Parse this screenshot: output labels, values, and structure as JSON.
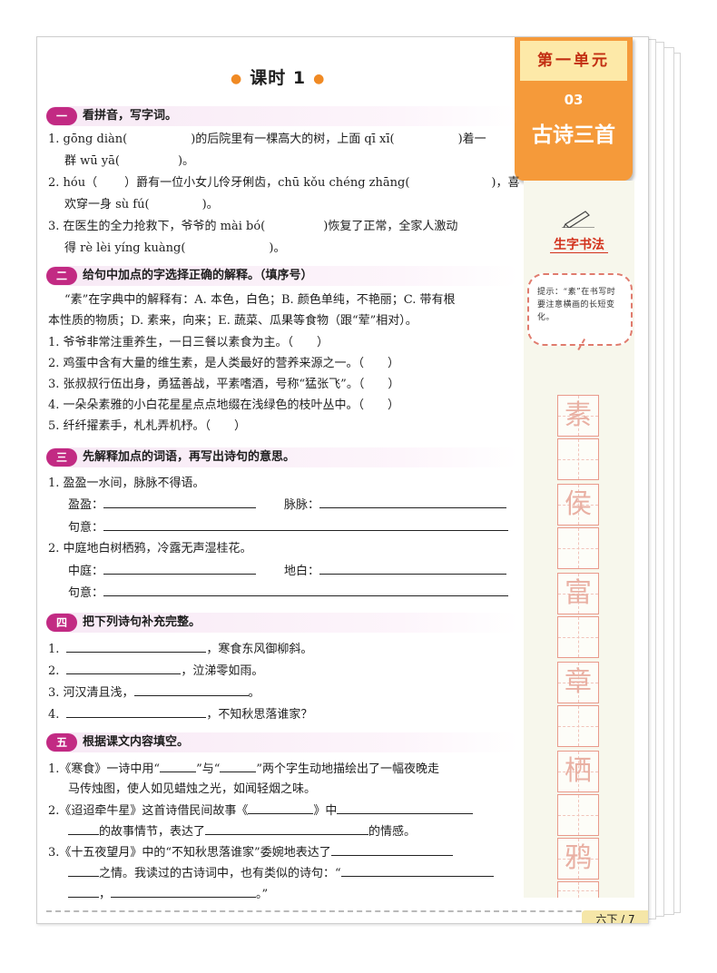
{
  "lesson_title": "课时 1",
  "unit": {
    "label": "第一单元",
    "number": "03",
    "title": "古诗三首"
  },
  "side": {
    "calligraphy_title": "生字书法",
    "tip": "提示：“素”在书写时要注意横画的长短变化。",
    "characters": [
      "素",
      "侯",
      "富",
      "章",
      "栖",
      "鸦"
    ]
  },
  "sections": [
    {
      "num": "一",
      "title": "看拼音，写字词。"
    },
    {
      "num": "二",
      "title": "给句中加点的字选择正确的解释。（填序号）"
    },
    {
      "num": "三",
      "title": "先解释加点的词语，再写出诗句的意思。"
    },
    {
      "num": "四",
      "title": "把下列诗句补充完整。"
    },
    {
      "num": "五",
      "title": "根据课文内容填空。"
    }
  ],
  "s1": {
    "l1a": "1. gōng diàn(",
    "l1b": ")的后院里有一棵高大的树，上面 qī xī(",
    "l1c": ")着一",
    "l2a": "群 wū yā(",
    "l2b": ")。",
    "l3a": "2. hóu（",
    "l3b": "）爵有一位小女儿伶牙俐齿，chū kǒu chéng zhāng(",
    "l3c": ")，喜",
    "l4a": "欢穿一身 sù fú(",
    "l4b": ")。",
    "l5a": "3. 在医生的全力抢救下，爷爷的 mài bó(",
    "l5b": ")恢复了正常，全家人激动",
    "l6a": "得 rè lèi yíng kuàng(",
    "l6b": ")。"
  },
  "s2": {
    "def1": "“素”在字典中的解释有：A. 本色，白色；B. 颜色单纯，不艳丽；C. 带有根",
    "def2": "本性质的物质；D. 素来，向来；E. 蔬菜、瓜果等食物（跟“荤”相对）。",
    "q1": "1. 爷爷非常注重养生，一日三餐以素食为主。（　　）",
    "q2": "2. 鸡蛋中含有大量的维生素，是人类最好的营养来源之一。（　　）",
    "q3": "3. 张叔叔行伍出身，勇猛善战，平素嗜酒，号称“猛张飞”。（　　）",
    "q4": "4. 一朵朵素雅的小白花星星点点地缀在浅绿色的枝叶丛中。（　　）",
    "q5": "5. 纤纤擢素手，札札弄机杼。（　　）"
  },
  "s3": {
    "p1": "1. 盈盈一水间，脉脉不得语。",
    "p1w1": "盈盈：",
    "p1w2": "脉脉：",
    "p1m": "句意：",
    "p2": "2. 中庭地白树栖鸦，冷露无声湿桂花。",
    "p2w1": "中庭：",
    "p2w2": "地白：",
    "p2m": "句意："
  },
  "s4": {
    "l1n": "1.",
    "l1t": "，寒食东风御柳斜。",
    "l2n": "2.",
    "l2t": "，泣涕零如雨。",
    "l3": "3. 河汉清且浅，",
    "l3e": "。",
    "l4n": "4.",
    "l4t": "，不知秋思落谁家？"
  },
  "s5": {
    "l1a": "1.《寒食》一诗中用“",
    "l1b": "”与“",
    "l1c": "”两个字生动地描绘出了一幅夜晚走",
    "l2": "马传烛图，使人如见蜡烛之光，如闻轻烟之味。",
    "l3a": "2.《迢迢牵牛星》这首诗借民间故事《",
    "l3b": "》中",
    "l4a": "的故事情节，表达了",
    "l4b": "的情感。",
    "l5a": "3.《十五夜望月》中的“不知秋思落谁家”委婉地表达了",
    "l6a": "之情。我读过的古诗词中，也有类似的诗句：“",
    "l7a": "，",
    "l7b": "。”"
  },
  "footer": "六下 / 7"
}
